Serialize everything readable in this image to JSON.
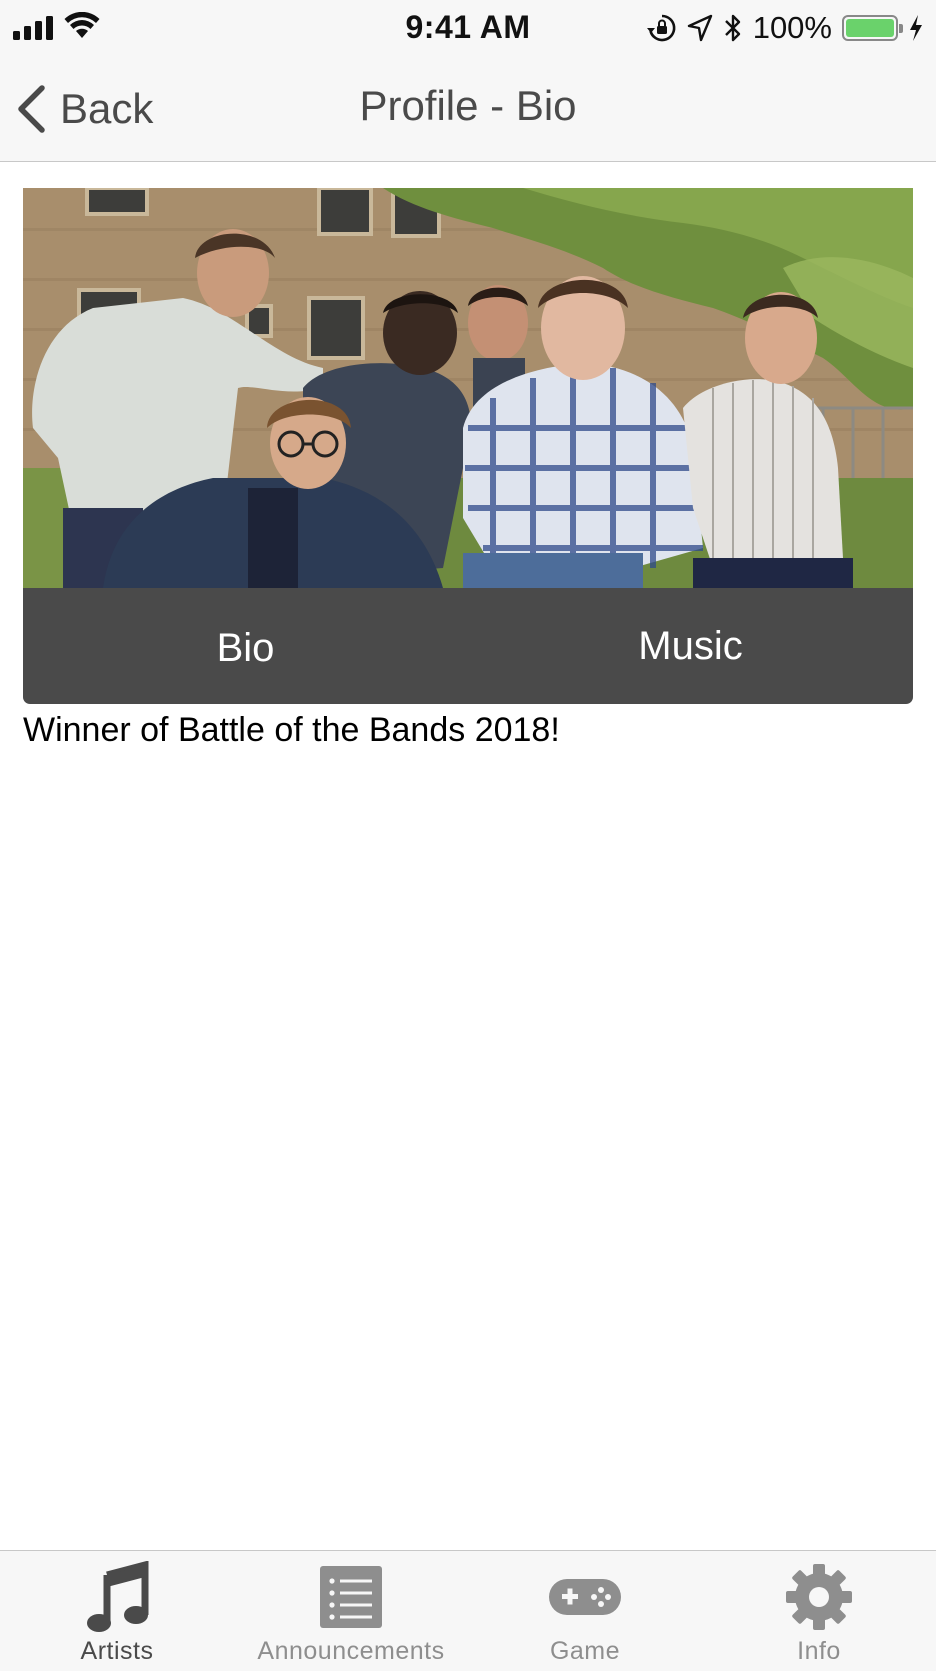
{
  "status_bar": {
    "time": "9:41 AM",
    "battery_percent": "100%",
    "battery_level": 1.0,
    "icons": [
      "cellular-signal-icon",
      "wifi-icon",
      "orientation-lock-icon",
      "location-icon",
      "bluetooth-icon",
      "battery-icon",
      "charging-icon"
    ]
  },
  "nav": {
    "back_label": "Back",
    "title": "Profile - Bio"
  },
  "segments": {
    "bio_label": "Bio",
    "music_label": "Music"
  },
  "bio": {
    "text": "Winner of Battle of the Bands 2018!"
  },
  "tab_bar": {
    "tabs": [
      {
        "label": "Artists",
        "icon": "music-note-icon",
        "active": true
      },
      {
        "label": "Announcements",
        "icon": "list-icon",
        "active": false
      },
      {
        "label": "Game",
        "icon": "gamepad-icon",
        "active": false
      },
      {
        "label": "Info",
        "icon": "gear-icon",
        "active": false
      }
    ]
  },
  "colors": {
    "accent_dark": "#4a4a4a",
    "inactive": "#8e8e8e",
    "battery_fill": "#6ad26b"
  }
}
